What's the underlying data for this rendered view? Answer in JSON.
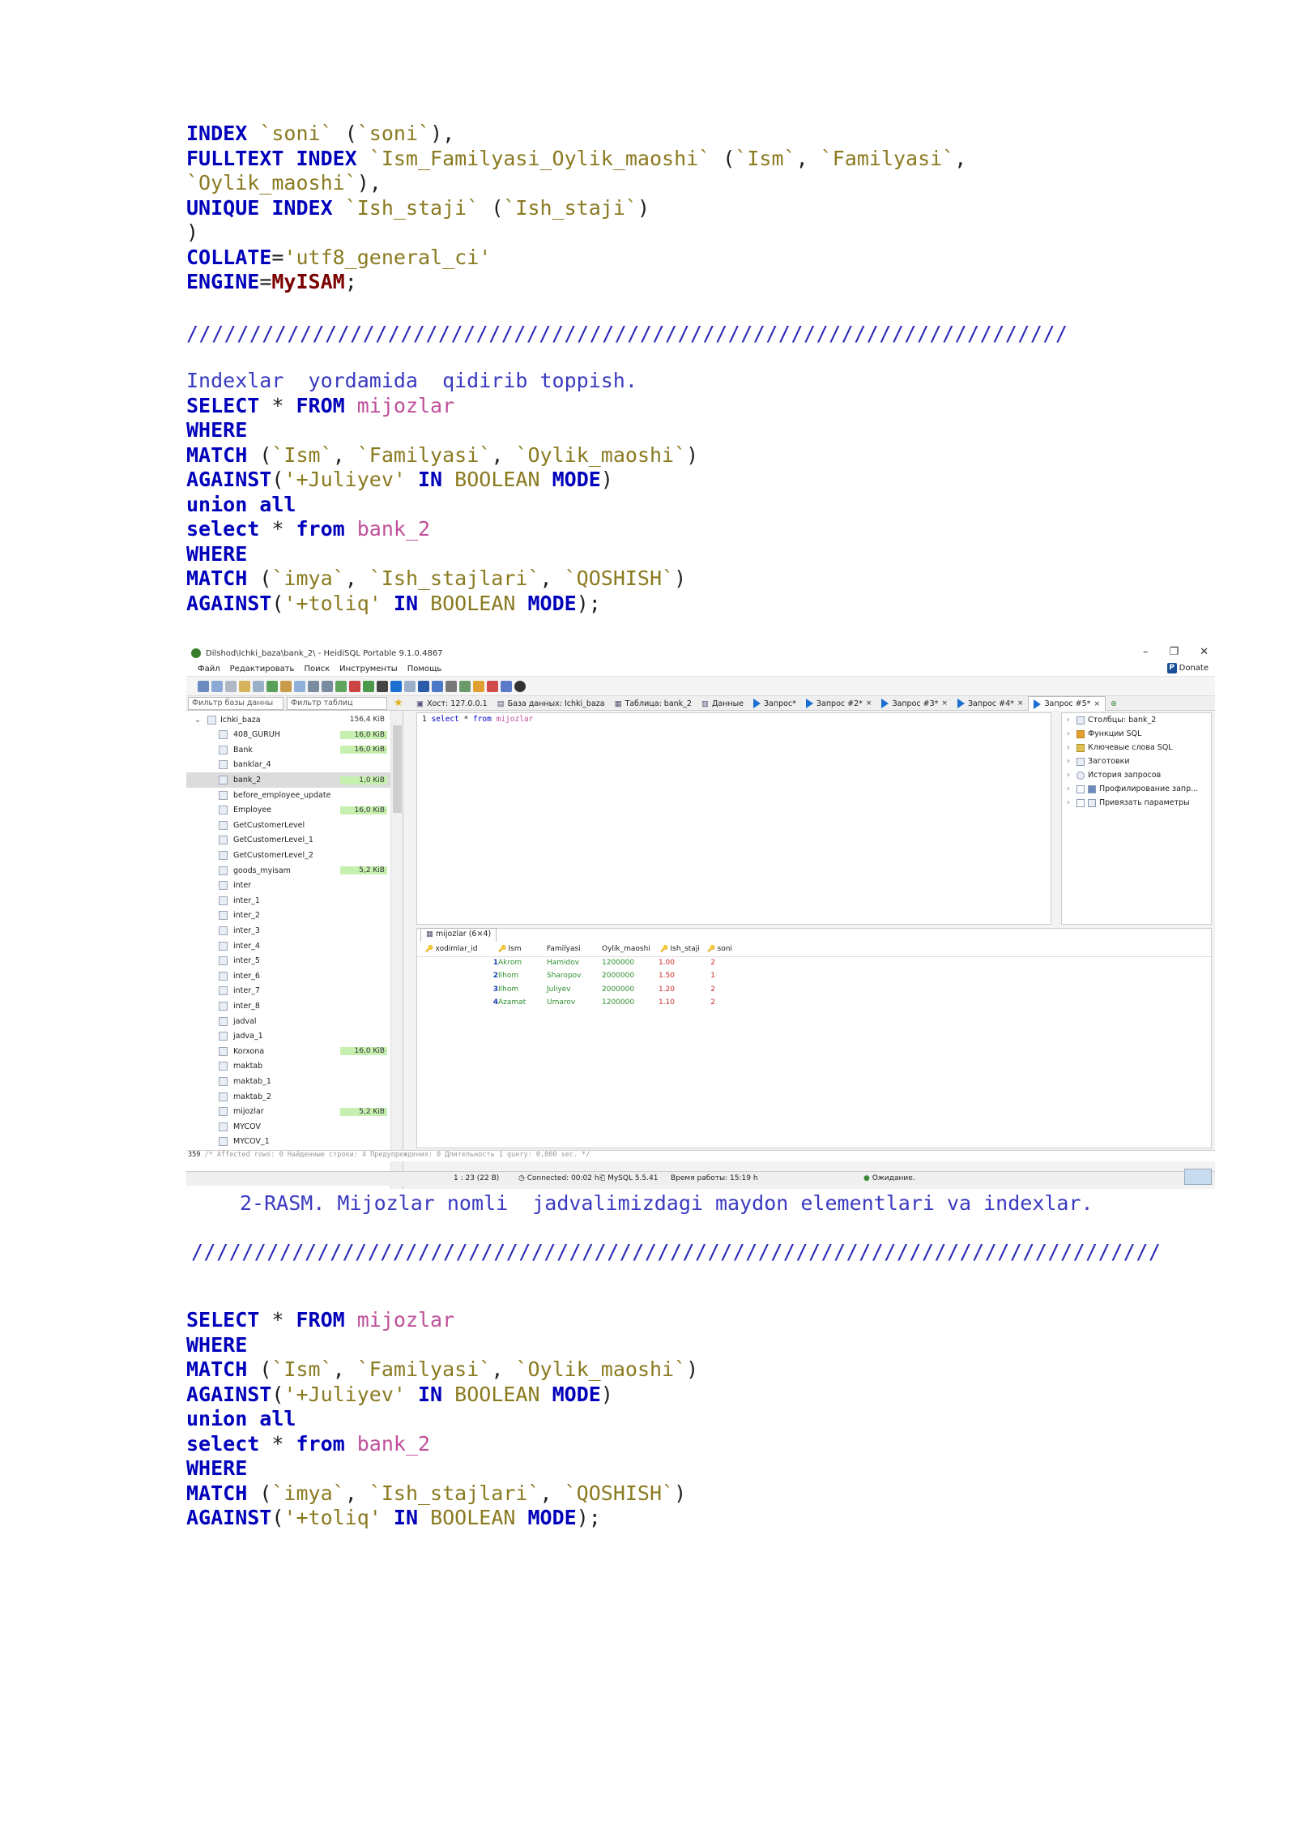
{
  "block1": {
    "lines": [
      [
        [
          "kw",
          "INDEX"
        ],
        [
          "pl",
          " "
        ],
        [
          "str",
          "`soni`"
        ],
        [
          "pl",
          " ("
        ],
        [
          "str",
          "`soni`"
        ],
        [
          "pl",
          "),"
        ]
      ],
      [
        [
          "kw",
          "FULLTEXT INDEX"
        ],
        [
          "pl",
          " "
        ],
        [
          "str",
          "`Ism_Familyasi_Oylik_maoshi`"
        ],
        [
          "pl",
          " ("
        ],
        [
          "str",
          "`Ism`"
        ],
        [
          "pl",
          ", "
        ],
        [
          "str",
          "`Familyasi`"
        ],
        [
          "pl",
          ","
        ]
      ],
      [
        [
          "str",
          "`Oylik_maoshi`"
        ],
        [
          "pl",
          "),"
        ]
      ],
      [
        [
          "kw",
          "UNIQUE INDEX"
        ],
        [
          "pl",
          " "
        ],
        [
          "str",
          "`Ish_staji`"
        ],
        [
          "pl",
          " ("
        ],
        [
          "str",
          "`Ish_staji`"
        ],
        [
          "pl",
          ")"
        ]
      ],
      [
        [
          "pl",
          ")"
        ]
      ],
      [
        [
          "kw",
          "COLLATE"
        ],
        [
          "pl",
          "="
        ],
        [
          "str",
          "'utf8_general_ci'"
        ]
      ],
      [
        [
          "kw",
          "ENGINE"
        ],
        [
          "pl",
          "="
        ],
        [
          "eng",
          "MyISAM"
        ],
        [
          "pl",
          ";"
        ]
      ]
    ]
  },
  "separator1": "//////////////////////////////////////////////////////////////////////",
  "block2": {
    "lines": [
      [
        [
          "cm",
          "Indexlar  yordamida  qidirib toppish."
        ]
      ],
      [
        [
          "kw",
          "SELECT"
        ],
        [
          "pl",
          " * "
        ],
        [
          "kw",
          "FROM"
        ],
        [
          "pl",
          " "
        ],
        [
          "tbl",
          "mijozlar"
        ]
      ],
      [
        [
          "kw",
          "WHERE"
        ]
      ],
      [
        [
          "kw",
          "MATCH"
        ],
        [
          "pl",
          " ("
        ],
        [
          "str",
          "`Ism`"
        ],
        [
          "pl",
          ", "
        ],
        [
          "str",
          "`Familyasi`"
        ],
        [
          "pl",
          ", "
        ],
        [
          "str",
          "`Oylik_maoshi`"
        ],
        [
          "pl",
          ")"
        ]
      ],
      [
        [
          "kw",
          "AGAINST"
        ],
        [
          "pl",
          "("
        ],
        [
          "str",
          "'+Juliyev'"
        ],
        [
          "pl",
          " "
        ],
        [
          "kw",
          "IN"
        ],
        [
          "pl",
          " "
        ],
        [
          "str",
          "BOOLEAN"
        ],
        [
          "pl",
          " "
        ],
        [
          "kw",
          "MODE"
        ],
        [
          "pl",
          ")"
        ]
      ],
      [
        [
          "kw",
          "union all"
        ]
      ],
      [
        [
          "kw",
          "select"
        ],
        [
          "pl",
          " * "
        ],
        [
          "kw",
          "from"
        ],
        [
          "pl",
          " "
        ],
        [
          "tbl",
          "bank_2"
        ]
      ],
      [
        [
          "kw",
          "WHERE"
        ]
      ],
      [
        [
          "kw",
          "MATCH"
        ],
        [
          "pl",
          " ("
        ],
        [
          "str",
          "`imya`"
        ],
        [
          "pl",
          ", "
        ],
        [
          "str",
          "`Ish_stajlari`"
        ],
        [
          "pl",
          ", "
        ],
        [
          "str",
          "`QOSHISH`"
        ],
        [
          "pl",
          ")"
        ]
      ],
      [
        [
          "kw",
          "AGAINST"
        ],
        [
          "pl",
          "("
        ],
        [
          "str",
          "'+toliq'"
        ],
        [
          "pl",
          " "
        ],
        [
          "kw",
          "IN"
        ],
        [
          "pl",
          " "
        ],
        [
          "str",
          "BOOLEAN"
        ],
        [
          "pl",
          " "
        ],
        [
          "kw",
          "MODE"
        ],
        [
          "pl",
          ");"
        ]
      ]
    ]
  },
  "screenshot": {
    "window_title": "Dilshod\\Ichki_baza\\bank_2\\ - HeidiSQL Portable 9.1.0.4867",
    "menu": [
      "Файл",
      "Редактировать",
      "Поиск",
      "Инструменты",
      "Помощь"
    ],
    "donate": "Donate",
    "filter_db": "Фильтр базы данны",
    "filter_table": "Фильтр таблиц",
    "tabs": [
      {
        "label": "Хост: 127.0.0.1",
        "type": "host"
      },
      {
        "label": "База данных: Ichki_baza",
        "type": "db"
      },
      {
        "label": "Таблица: bank_2",
        "type": "table"
      },
      {
        "label": "Данные",
        "type": "data"
      },
      {
        "label": "Запрос*",
        "type": "query"
      },
      {
        "label": "Запрос #2*",
        "type": "query",
        "close": "×"
      },
      {
        "label": "Запрос #3*",
        "type": "query",
        "close": "×"
      },
      {
        "label": "Запрос #4*",
        "type": "query",
        "close": "×"
      },
      {
        "label": "Запрос #5*",
        "type": "query",
        "close": "×",
        "active": true
      }
    ],
    "tree": {
      "db": {
        "name": "Ichki_baza",
        "size": "156,4 KiB"
      },
      "items": [
        {
          "name": "408_GURUH",
          "size": "16,0 KiB",
          "bar": true
        },
        {
          "name": "Bank",
          "size": "16,0 KiB",
          "bar": true
        },
        {
          "name": "banklar_4",
          "size": ""
        },
        {
          "name": "bank_2",
          "size": "1,0 KiB",
          "bar": true,
          "selected": true
        },
        {
          "name": "before_employee_update",
          "size": ""
        },
        {
          "name": "Employee",
          "size": "16,0 KiB",
          "bar": true
        },
        {
          "name": "GetCustomerLevel",
          "size": ""
        },
        {
          "name": "GetCustomerLevel_1",
          "size": ""
        },
        {
          "name": "GetCustomerLevel_2",
          "size": ""
        },
        {
          "name": "goods_myisam",
          "size": "5,2 KiB",
          "bar": true
        },
        {
          "name": "inter",
          "size": ""
        },
        {
          "name": "inter_1",
          "size": ""
        },
        {
          "name": "inter_2",
          "size": ""
        },
        {
          "name": "inter_3",
          "size": ""
        },
        {
          "name": "inter_4",
          "size": ""
        },
        {
          "name": "inter_5",
          "size": ""
        },
        {
          "name": "inter_6",
          "size": ""
        },
        {
          "name": "inter_7",
          "size": ""
        },
        {
          "name": "inter_8",
          "size": ""
        },
        {
          "name": "jadval",
          "size": ""
        },
        {
          "name": "jadva_1",
          "size": ""
        },
        {
          "name": "Korxona",
          "size": "16,0 KiB",
          "bar": true
        },
        {
          "name": "maktab",
          "size": ""
        },
        {
          "name": "maktab_1",
          "size": ""
        },
        {
          "name": "maktab_2",
          "size": ""
        },
        {
          "name": "mijozlar",
          "size": "5,2 KiB",
          "bar": true
        },
        {
          "name": "MYCOV",
          "size": ""
        },
        {
          "name": "MYCOV_1",
          "size": ""
        }
      ]
    },
    "editor": {
      "line_no": "1",
      "kw1": "select",
      "star": " * ",
      "kw2": "from",
      "table": "mijozlar"
    },
    "helper": [
      "Столбцы: bank_2",
      "Функции SQL",
      "Ключевые слова SQL",
      "Заготовки",
      "История запросов",
      "Профилирование запр...",
      "Привязать параметры"
    ],
    "result_tab": "mijozlar (6×4)",
    "grid": {
      "columns": [
        "xodimlar_id",
        "Ism",
        "Familyasi",
        "Oylik_maoshi",
        "Ish_staji",
        "soni"
      ],
      "rows": [
        [
          "1",
          "Akrom",
          "Hamidov",
          "1200000",
          "1.00",
          "2"
        ],
        [
          "2",
          "Ilhom",
          "Sharopov",
          "2000000",
          "1.50",
          "1"
        ],
        [
          "3",
          "Ilhom",
          "Juliyev",
          "2000000",
          "1.20",
          "2"
        ],
        [
          "4",
          "Azamat",
          "Umarov",
          "1200000",
          "1.10",
          "2"
        ]
      ]
    },
    "message_num": "359",
    "message": "/* Affected rows: 0  Найденные строки: 4  Предупреждения: 0  Длительность  1 query: 0,000 sec. */",
    "status": {
      "pos": "1 : 23 (22 B)",
      "connected": "Connected: 00:02 h",
      "server": "MySQL 5.5.41",
      "uptime": "Время работы: 15:19 h",
      "state": "Ожидание."
    }
  },
  "caption": "2-RASM. Mijozlar nomli  jadvalimizdagi maydon elementlari va indexlar.",
  "separator2": "/////////////////////////////////////////////////////////////////////////////",
  "block3": {
    "lines": [
      [
        [
          "kw",
          "SELECT"
        ],
        [
          "pl",
          " * "
        ],
        [
          "kw",
          "FROM"
        ],
        [
          "pl",
          " "
        ],
        [
          "tbl",
          "mijozlar"
        ]
      ],
      [
        [
          "kw",
          "WHERE"
        ]
      ],
      [
        [
          "kw",
          "MATCH"
        ],
        [
          "pl",
          " ("
        ],
        [
          "str",
          "`Ism`"
        ],
        [
          "pl",
          ", "
        ],
        [
          "str",
          "`Familyasi`"
        ],
        [
          "pl",
          ", "
        ],
        [
          "str",
          "`Oylik_maoshi`"
        ],
        [
          "pl",
          ")"
        ]
      ],
      [
        [
          "kw",
          "AGAINST"
        ],
        [
          "pl",
          "("
        ],
        [
          "str",
          "'+Juliyev'"
        ],
        [
          "pl",
          " "
        ],
        [
          "kw",
          "IN"
        ],
        [
          "pl",
          " "
        ],
        [
          "str",
          "BOOLEAN"
        ],
        [
          "pl",
          " "
        ],
        [
          "kw",
          "MODE"
        ],
        [
          "pl",
          ")"
        ]
      ],
      [
        [
          "kw",
          "union all"
        ]
      ],
      [
        [
          "kw",
          "select"
        ],
        [
          "pl",
          " * "
        ],
        [
          "kw",
          "from"
        ],
        [
          "pl",
          " "
        ],
        [
          "tbl",
          "bank_2"
        ]
      ],
      [
        [
          "kw",
          "WHERE"
        ]
      ],
      [
        [
          "kw",
          "MATCH"
        ],
        [
          "pl",
          " ("
        ],
        [
          "str",
          "`imya`"
        ],
        [
          "pl",
          ", "
        ],
        [
          "str",
          "`Ish_stajlari`"
        ],
        [
          "pl",
          ", "
        ],
        [
          "str",
          "`QOSHISH`"
        ],
        [
          "pl",
          ")"
        ]
      ],
      [
        [
          "kw",
          "AGAINST"
        ],
        [
          "pl",
          "("
        ],
        [
          "str",
          "'+toliq'"
        ],
        [
          "pl",
          " "
        ],
        [
          "kw",
          "IN"
        ],
        [
          "pl",
          " "
        ],
        [
          "str",
          "BOOLEAN"
        ],
        [
          "pl",
          " "
        ],
        [
          "kw",
          "MODE"
        ],
        [
          "pl",
          ");"
        ]
      ]
    ]
  }
}
